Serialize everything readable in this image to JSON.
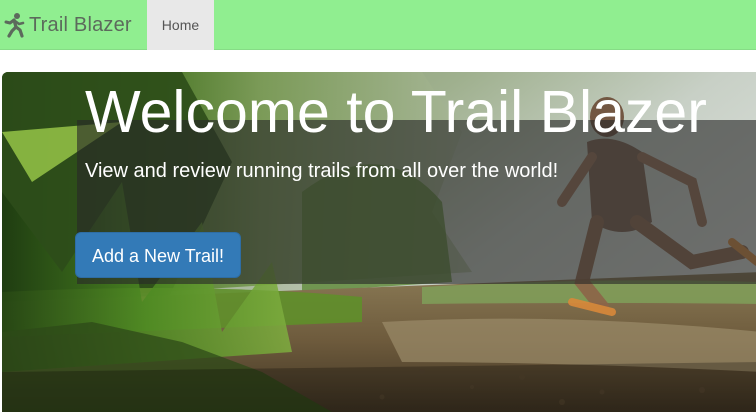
{
  "navbar": {
    "brand_icon": "running-person-icon",
    "brand_text": "Trail Blazer",
    "items": [
      {
        "label": "Home",
        "active": true
      }
    ]
  },
  "hero": {
    "title": "Welcome to Trail Blazer",
    "subtitle": "View and review running trails from all over the world!",
    "cta_label": "Add a New Trail!"
  },
  "colors": {
    "navbar_bg": "#90ee90",
    "active_nav_bg": "#e8e8e8",
    "cta_bg": "#337ab7"
  }
}
